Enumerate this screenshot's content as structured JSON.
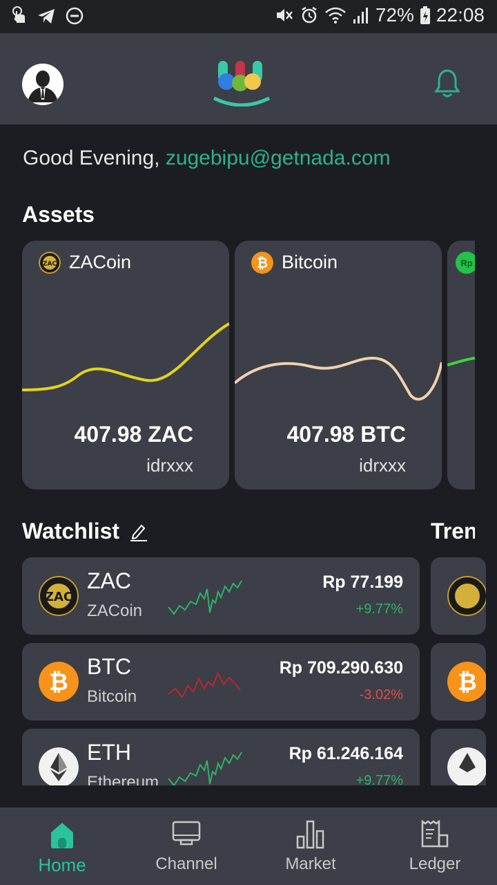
{
  "status_bar": {
    "battery": "72%",
    "time": "22:08"
  },
  "greeting": {
    "prefix": "Good Evening, ",
    "email": "zugebipu@getnada.com"
  },
  "assets": {
    "title": "Assets",
    "cards": [
      {
        "name": "ZACoin",
        "amount": "407.98 ZAC",
        "sub": "idrxxx",
        "icon": "zacoin-icon",
        "line_color": "#e3d31c"
      },
      {
        "name": "Bitcoin",
        "amount": "407.98 BTC",
        "sub": "idrxxx",
        "icon": "bitcoin-icon",
        "line_color": "#efd2ae"
      },
      {
        "icon_text": "Rp",
        "icon": "rupiah-icon",
        "line_color": "#3fd43a"
      }
    ]
  },
  "watchlist": {
    "title": "Watchlist",
    "rows": [
      {
        "symbol": "ZAC",
        "name": "ZACoin",
        "price": "Rp 77.199",
        "change": "+9.77%",
        "trend": "up"
      },
      {
        "symbol": "BTC",
        "name": "Bitcoin",
        "price": "Rp 709.290.630",
        "change": "-3.02%",
        "trend": "down"
      },
      {
        "symbol": "ETH",
        "name": "Ethereum",
        "price": "Rp 61.246.164",
        "change": "+9.77%",
        "trend": "up"
      }
    ]
  },
  "trending": {
    "title": "Trending"
  },
  "bottom_nav": [
    {
      "label": "Home",
      "icon": "home-icon",
      "active": true
    },
    {
      "label": "Channel",
      "icon": "monitor-icon",
      "active": false
    },
    {
      "label": "Market",
      "icon": "bar-chart-icon",
      "active": false
    },
    {
      "label": "Ledger",
      "icon": "receipt-icon",
      "active": false
    }
  ],
  "colors": {
    "accent": "#2bb38f",
    "up": "#2fb26a",
    "down": "#e04b4b",
    "card": "#3c3f47",
    "background": "#1c1d22"
  }
}
